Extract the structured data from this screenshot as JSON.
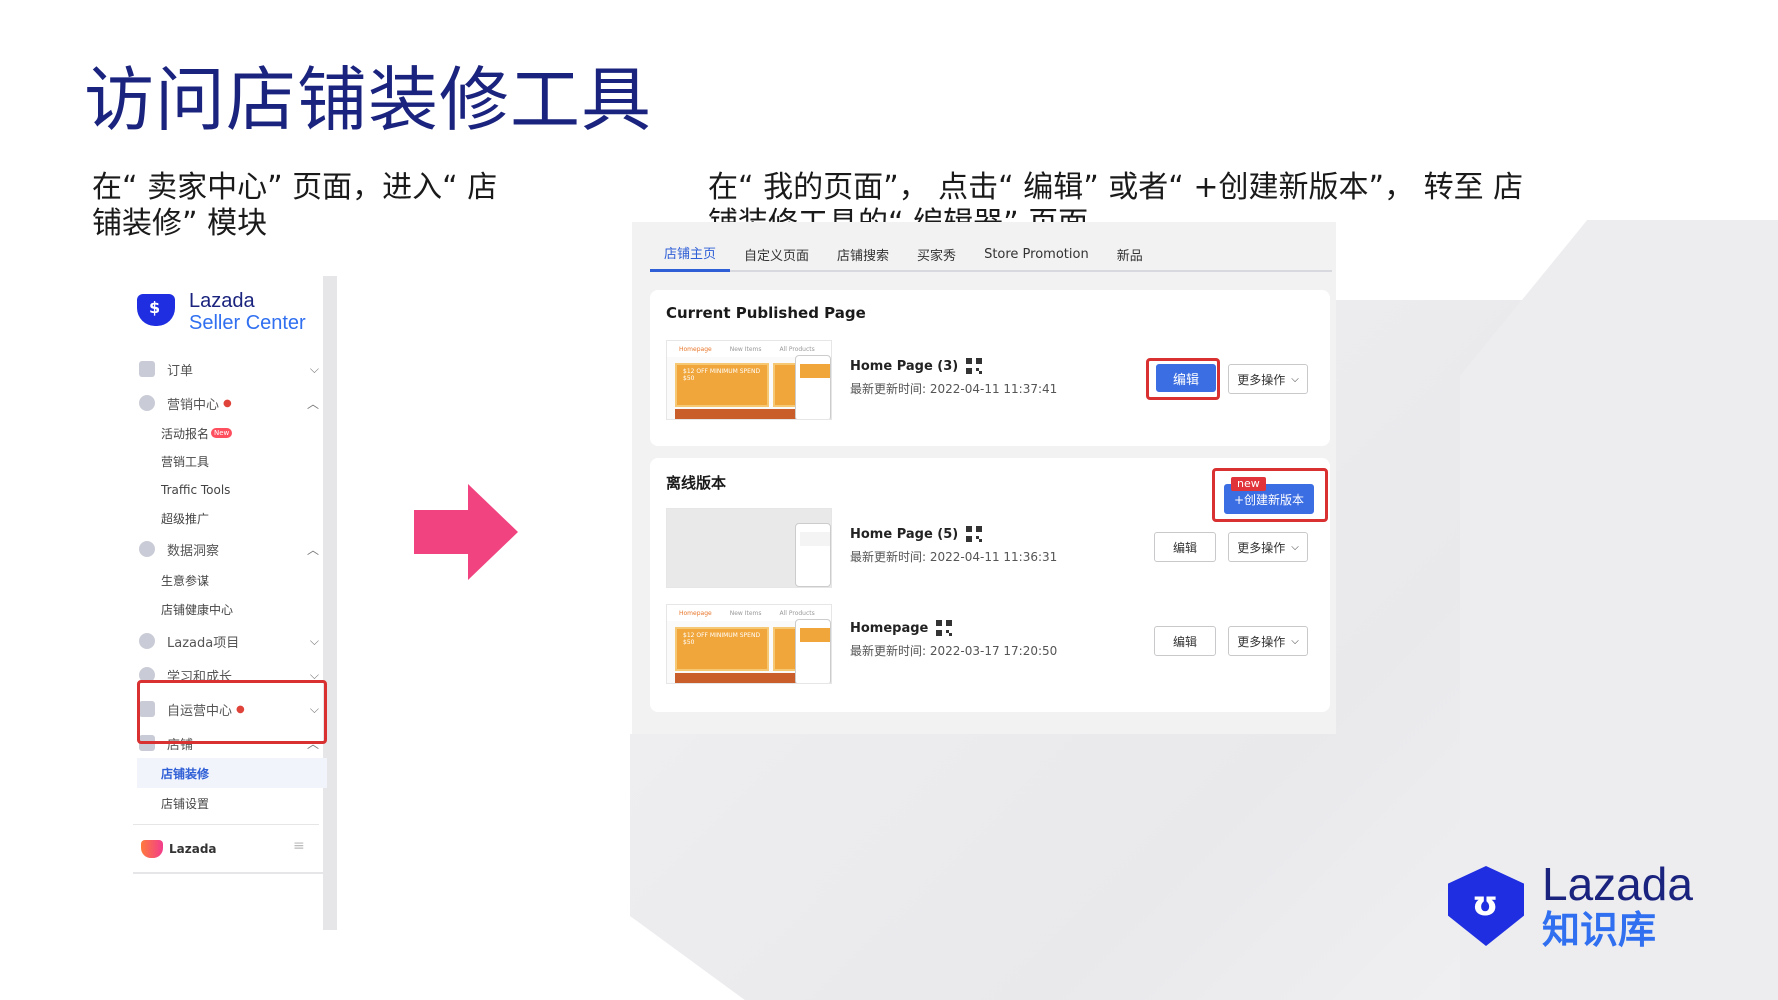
{
  "title": "访问店铺装修工具",
  "desc_left": "在“ 卖家中心” 页面，进入“ 店铺装修” 模块",
  "desc_right": "在“ 我的页面”， 点击“ 编辑” 或者“ +创建新版本”， 转至 店铺装修工具的“ 编辑器” 页面。",
  "sidebar": {
    "logo_line1": "Lazada",
    "logo_line2": "Seller Center",
    "items": [
      {
        "label": "订单"
      },
      {
        "label": "营销中心"
      },
      {
        "label": "数据洞察"
      },
      {
        "label": "Lazada项目"
      },
      {
        "label": "学习和成长"
      },
      {
        "label": "自运营中心"
      },
      {
        "label": "店铺"
      }
    ],
    "marketing_subs": [
      "活动报名",
      "营销工具",
      "Traffic Tools",
      "超级推广"
    ],
    "new_tag": "New",
    "data_subs": [
      "生意参谋",
      "店铺健康中心"
    ],
    "store_subs": [
      "店铺装修",
      "店铺设置"
    ],
    "footer": "Lazada"
  },
  "editor": {
    "tabs": [
      "店铺主页",
      "自定义页面",
      "店铺搜索",
      "买家秀",
      "Store Promotion",
      "新品"
    ],
    "published_title": "Current Published Page",
    "offline_title": "离线版本",
    "thumb_labels": [
      "Homepage",
      "New Items",
      "All Products"
    ],
    "coupon_text": "$12 OFF MINIMUM SPEND $50",
    "pages": [
      {
        "name": "Home Page (3)",
        "time": "最新更新时间: 2022-04-11 11:37:41"
      },
      {
        "name": "Home Page (5)",
        "time": "最新更新时间: 2022-04-11 11:36:31"
      },
      {
        "name": "Homepage",
        "time": "最新更新时间: 2022-03-17 17:20:50"
      }
    ],
    "edit_label": "编辑",
    "more_label": "更多操作",
    "new_badge": "new",
    "create_label": "+创建新版本"
  },
  "brand": {
    "line1": "Lazada",
    "line2": "知识库"
  },
  "colors": {
    "title": "#1a237e",
    "accent": "#3b6de3",
    "highlight": "#d93131",
    "arrow": "#f0437f"
  }
}
